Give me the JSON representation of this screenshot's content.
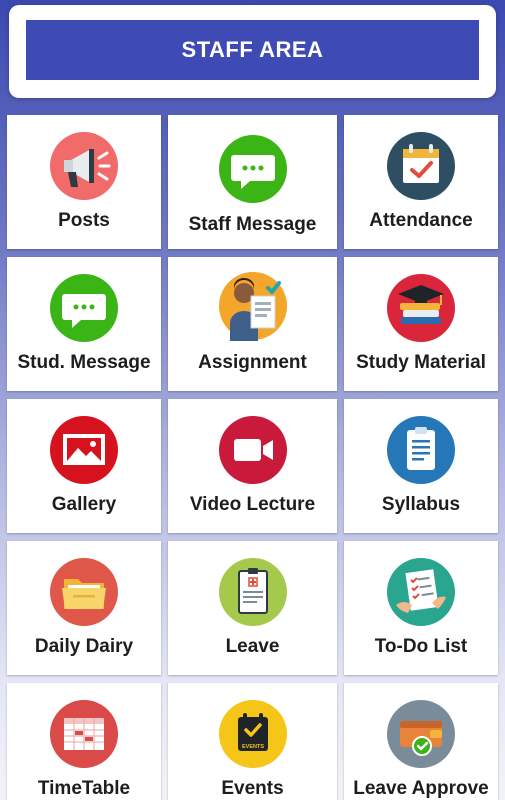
{
  "header": {
    "title": "STAFF AREA"
  },
  "tiles": [
    {
      "label": "Posts",
      "icon": "megaphone-icon",
      "color": "#f26b6b"
    },
    {
      "label": "Staff Message",
      "icon": "chat-icon",
      "color": "#3bb515"
    },
    {
      "label": "Attendance",
      "icon": "calendar-check-icon",
      "color": "#2e4e63"
    },
    {
      "label": "Stud. Message",
      "icon": "chat-icon",
      "color": "#3bb515"
    },
    {
      "label": "Assignment",
      "icon": "student-assignment-icon",
      "color": "#f4a62a"
    },
    {
      "label": "Study Material",
      "icon": "books-cap-icon",
      "color": "#d9263a"
    },
    {
      "label": "Gallery",
      "icon": "image-icon",
      "color": "#d5121e"
    },
    {
      "label": "Video Lecture",
      "icon": "video-camera-icon",
      "color": "#c91a3c"
    },
    {
      "label": "Syllabus",
      "icon": "clipboard-icon",
      "color": "#2577b8"
    },
    {
      "label": "Daily Dairy",
      "icon": "folder-icon",
      "color": "#e0584a"
    },
    {
      "label": "Leave",
      "icon": "medical-document-icon",
      "color": "#a5c94a"
    },
    {
      "label": "To-Do List",
      "icon": "checklist-hands-icon",
      "color": "#2aa58f"
    },
    {
      "label": "TimeTable",
      "icon": "timetable-icon",
      "color": "#d94a48"
    },
    {
      "label": "Events",
      "icon": "events-calendar-icon",
      "color": "#f5c518",
      "icon_text": "EVENTS"
    },
    {
      "label": "Leave Approve",
      "icon": "wallet-approve-icon",
      "color": "#7a8c9a"
    }
  ]
}
